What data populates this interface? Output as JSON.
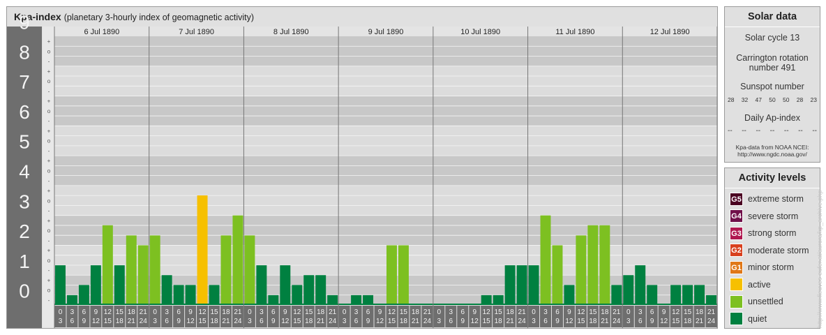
{
  "header": {
    "title": "Kpa-index",
    "subtitle": "(planetary 3-hourly index of geomagnetic activity)"
  },
  "chart_data": {
    "type": "bar",
    "title": "Kpa-index",
    "subtitle": "(planetary 3-hourly index of geomagnetic activity)",
    "ylim": [
      0,
      9
    ],
    "y_ticks": [
      "0",
      "1",
      "2",
      "3",
      "4",
      "5",
      "6",
      "7",
      "8",
      "9"
    ],
    "minor_ticks": [
      "-",
      "o",
      "+"
    ],
    "days": [
      "6 Jul 1890",
      "7 Jul 1890",
      "8 Jul 1890",
      "9 Jul 1890",
      "10 Jul 1890",
      "11 Jul 1890",
      "12 Jul 1890"
    ],
    "hour_start": [
      "0",
      "3",
      "6",
      "9",
      "12",
      "15",
      "18",
      "21"
    ],
    "hour_end": [
      "3",
      "6",
      "9",
      "12",
      "15",
      "18",
      "21",
      "24"
    ],
    "values": [
      [
        1.33,
        0.33,
        0.67,
        1.33,
        2.67,
        1.33,
        2.33,
        2.0
      ],
      [
        2.33,
        1.0,
        0.67,
        0.67,
        3.67,
        0.67,
        2.33,
        3.0
      ],
      [
        2.33,
        1.33,
        0.33,
        1.33,
        0.67,
        1.0,
        1.0,
        0.33
      ],
      [
        0.0,
        0.33,
        0.33,
        0.0,
        2.0,
        2.0,
        0.0,
        0.0
      ],
      [
        0.0,
        0.0,
        0.0,
        0.0,
        0.33,
        0.33,
        1.33,
        1.33
      ],
      [
        1.33,
        3.0,
        2.0,
        0.67,
        2.33,
        2.67,
        2.67,
        0.67
      ],
      [
        1.0,
        1.33,
        0.67,
        0.0,
        0.67,
        0.67,
        0.67,
        0.33
      ]
    ],
    "grid": true
  },
  "solar": {
    "title": "Solar data",
    "cycle": "Solar cycle 13",
    "carrington_line1": "Carrington rotation",
    "carrington_line2": "number 491",
    "sunspot_label": "Sunspot number",
    "sunspot_values": [
      "28",
      "32",
      "47",
      "50",
      "50",
      "28",
      "23"
    ],
    "ap_label": "Daily Ap-index",
    "ap_values": [
      "--",
      "--",
      "--",
      "--",
      "--",
      "--",
      "--"
    ],
    "source_line1": "Kpa-data from NOAA NCEI:",
    "source_line2": "http://www.ngdc.noaa.gov/"
  },
  "activity": {
    "title": "Activity levels",
    "levels": [
      {
        "code": "G5",
        "label": "extreme storm",
        "color": "#4a0021"
      },
      {
        "code": "G4",
        "label": "severe storm",
        "color": "#70104a"
      },
      {
        "code": "G3",
        "label": "strong storm",
        "color": "#b01850"
      },
      {
        "code": "G2",
        "label": "moderate storm",
        "color": "#d8401e"
      },
      {
        "code": "G1",
        "label": "minor storm",
        "color": "#e07818"
      },
      {
        "code": "",
        "label": "active",
        "color": "#f6c000"
      },
      {
        "code": "",
        "label": "unsettled",
        "color": "#7dc021"
      },
      {
        "code": "",
        "label": "quiet",
        "color": "#008040"
      }
    ]
  },
  "colors": {
    "quiet": "#008040",
    "unsettled": "#7dc021",
    "active": "#f6c000",
    "band_dark": "#c8c8c8",
    "band_light": "#dcdcdc",
    "axis_gray": "#6e6e6e"
  },
  "credit": "http://www.fleuves-eufer.at/aurora/kp_archive.php"
}
